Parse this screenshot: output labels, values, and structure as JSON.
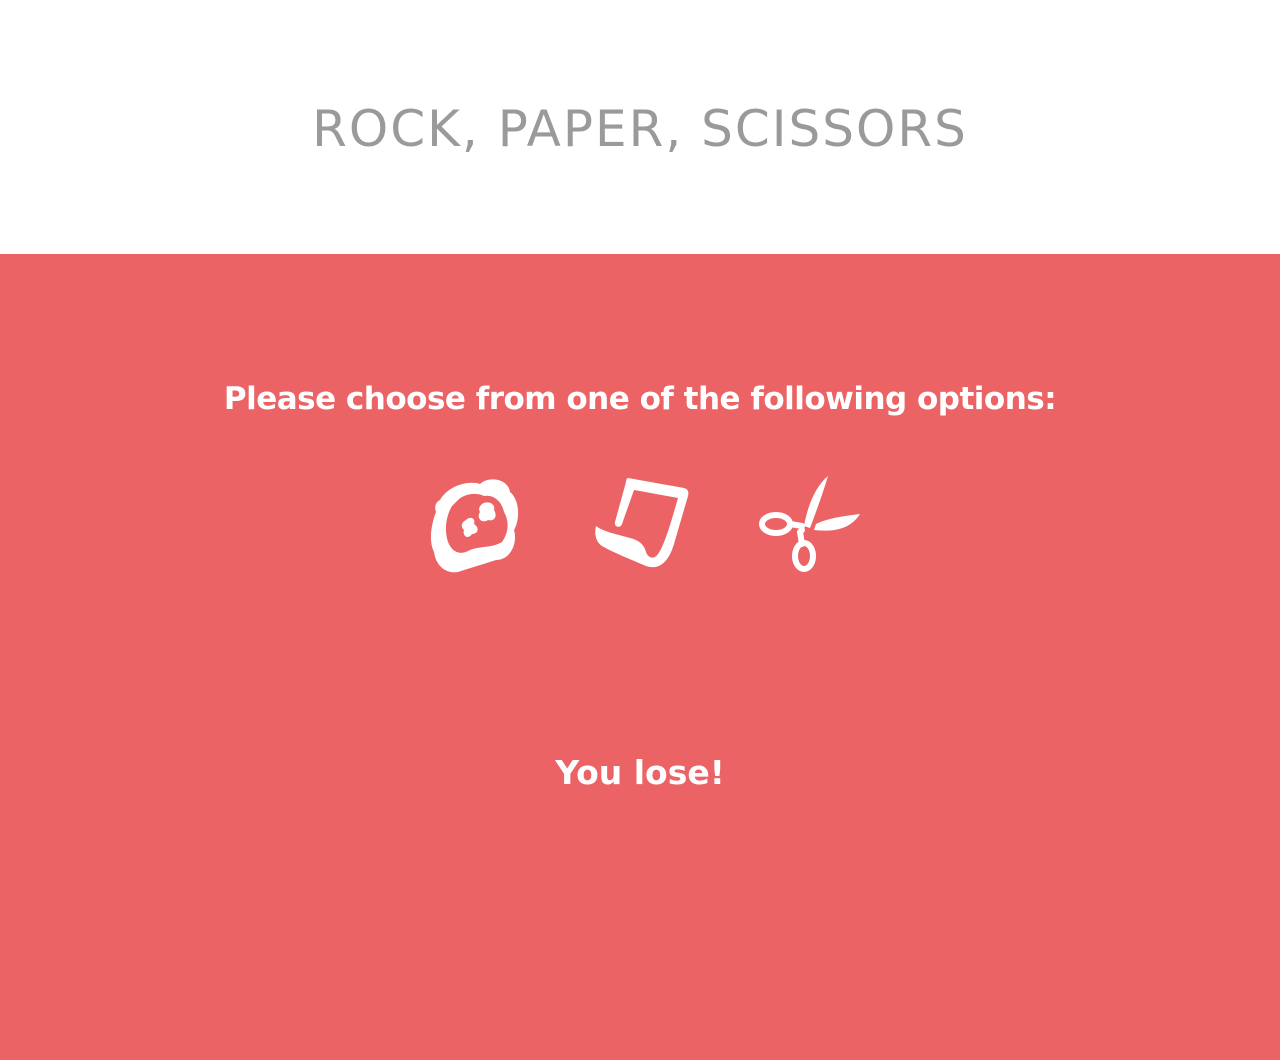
{
  "header": {
    "title": "ROCK, PAPER, SCISSORS"
  },
  "game": {
    "prompt": "Please choose from one of the following options:",
    "choices": [
      {
        "icon": "rock-icon"
      },
      {
        "icon": "paper-icon"
      },
      {
        "icon": "scissors-icon"
      }
    ],
    "result": "You lose!"
  },
  "colors": {
    "header_background": "#ffffff",
    "title_text": "#9a9a9a",
    "game_background": "#ec6366",
    "game_text": "#ffffff"
  }
}
